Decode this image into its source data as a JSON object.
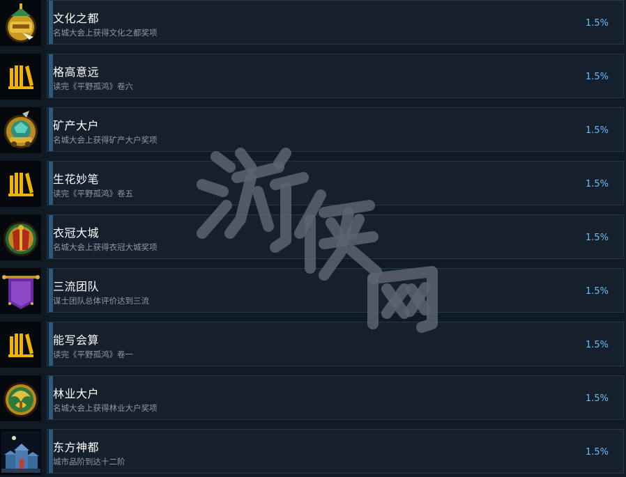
{
  "achievements": [
    {
      "icon": "golden-lantern-icon",
      "title": "文化之都",
      "desc": "名城大会上获得文化之都奖项",
      "pct": "1.5%"
    },
    {
      "icon": "books-icon",
      "title": "格高意远",
      "desc": "读完《平野孤鸿》卷六",
      "pct": "1.5%"
    },
    {
      "icon": "mine-cart-icon",
      "title": "矿产大户",
      "desc": "名城大会上获得矿产大户奖项",
      "pct": "1.5%"
    },
    {
      "icon": "books-icon",
      "title": "生花妙笔",
      "desc": "读完《平野孤鸿》卷五",
      "pct": "1.5%"
    },
    {
      "icon": "robe-medallion-icon",
      "title": "衣冠大城",
      "desc": "名城大会上获得衣冠大城奖项",
      "pct": "1.5%"
    },
    {
      "icon": "purple-banner-icon",
      "title": "三流团队",
      "desc": "谋士团队总体评价达到三流",
      "pct": "1.5%"
    },
    {
      "icon": "books-icon",
      "title": "能写会算",
      "desc": "读完《平野孤鸿》卷一",
      "pct": "1.5%"
    },
    {
      "icon": "forest-medallion-icon",
      "title": "林业大户",
      "desc": "名城大会上获得林业大户奖项",
      "pct": "1.5%"
    },
    {
      "icon": "palace-city-icon",
      "title": "东方神都",
      "desc": "城市品阶到达十二阶",
      "pct": "1.5%"
    }
  ],
  "watermark_text": "游侠网"
}
